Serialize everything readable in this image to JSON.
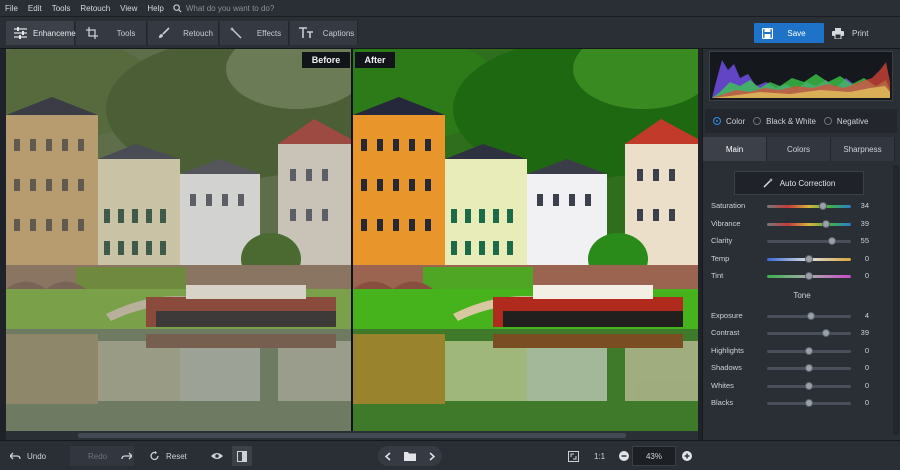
{
  "menu": [
    "File",
    "Edit",
    "Tools",
    "Retouch",
    "View",
    "Help"
  ],
  "search": {
    "placeholder": "What do you want to do?",
    "icon": "search-icon"
  },
  "tabs": [
    {
      "label": "Enhancement",
      "icon": "sliders-icon",
      "active": true
    },
    {
      "label": "Tools",
      "icon": "crop-icon",
      "active": false
    },
    {
      "label": "Retouch",
      "icon": "brush-icon",
      "active": false
    },
    {
      "label": "Effects",
      "icon": "magic-wand-icon",
      "active": false
    },
    {
      "label": "Captions",
      "icon": "text-icon",
      "active": false
    }
  ],
  "actions": {
    "save": "Save",
    "print": "Print"
  },
  "viewer": {
    "before_label": "Before",
    "after_label": "After"
  },
  "bottombar": {
    "undo": "Undo",
    "redo": "Redo",
    "reset": "Reset",
    "ratio": "1:1",
    "zoom": "43%"
  },
  "panel": {
    "modes": [
      {
        "label": "Color",
        "selected": true
      },
      {
        "label": "Black & White",
        "selected": false
      },
      {
        "label": "Negative",
        "selected": false
      }
    ],
    "subtabs": [
      {
        "label": "Main",
        "active": true
      },
      {
        "label": "Colors",
        "active": false
      },
      {
        "label": "Sharpness",
        "active": false
      }
    ],
    "auto_correction": "Auto Correction",
    "sliders_top": [
      {
        "label": "Saturation",
        "value": "34",
        "level": 0.67
      },
      {
        "label": "Vibrance",
        "value": "39",
        "level": 0.7
      },
      {
        "label": "Clarity",
        "value": "55",
        "level": 0.77
      },
      {
        "label": "Temp",
        "value": "0",
        "level": 0.5
      },
      {
        "label": "Tint",
        "value": "0",
        "level": 0.5
      }
    ],
    "tone_header": "Tone",
    "sliders_tone": [
      {
        "label": "Exposure",
        "value": "4",
        "level": 0.52
      },
      {
        "label": "Contrast",
        "value": "39",
        "level": 0.7
      },
      {
        "label": "Highlights",
        "value": "0",
        "level": 0.5
      },
      {
        "label": "Shadows",
        "value": "0",
        "level": 0.5
      },
      {
        "label": "Whites",
        "value": "0",
        "level": 0.5
      },
      {
        "label": "Blacks",
        "value": "0",
        "level": 0.5
      }
    ]
  },
  "colors": {
    "accent": "#1e73c8",
    "panel": "#2a2e35",
    "background": "#1f2329"
  }
}
